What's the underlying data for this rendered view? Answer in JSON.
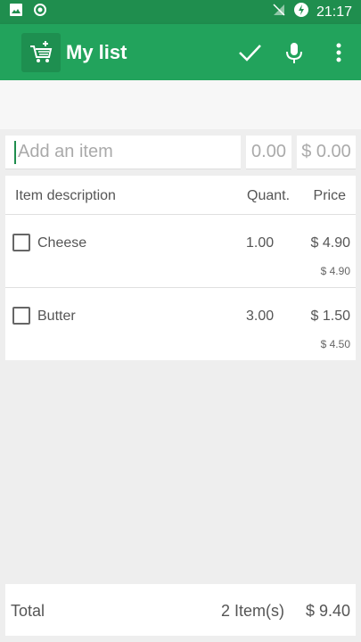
{
  "status_bar": {
    "time": "21:17",
    "icons": [
      "image-icon",
      "record-icon",
      "no-signal-icon",
      "battery-charging-icon"
    ]
  },
  "app_bar": {
    "title": "My list",
    "actions": [
      "check-icon",
      "microphone-icon",
      "more-vert-icon"
    ]
  },
  "add_item": {
    "placeholder": "Add an item",
    "quantity": "0.00",
    "price": "$ 0.00"
  },
  "list": {
    "headers": {
      "description": "Item description",
      "quantity": "Quant.",
      "price": "Price"
    },
    "items": [
      {
        "name": "Cheese",
        "quantity": "1.00",
        "price": "$ 4.90",
        "total": "$ 4.90",
        "checked": false
      },
      {
        "name": "Butter",
        "quantity": "3.00",
        "price": "$ 1.50",
        "total": "$ 4.50",
        "checked": false
      }
    ]
  },
  "footer": {
    "label": "Total",
    "count": "2 Item(s)",
    "sum": "$ 9.40"
  },
  "colors": {
    "status_bar": "#1f8e4e",
    "app_bar": "#22a35c",
    "background": "#eeeeee"
  }
}
